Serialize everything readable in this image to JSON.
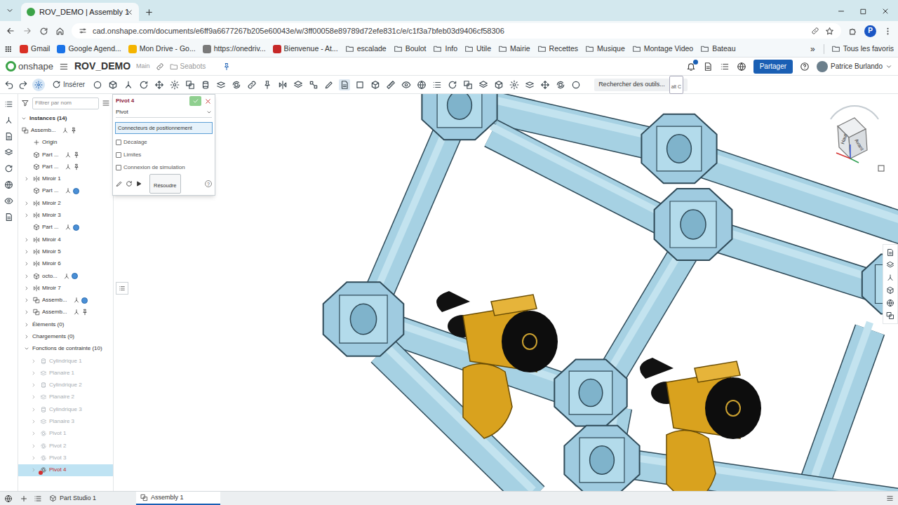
{
  "browser": {
    "tab_title": "ROV_DEMO | Assembly 1",
    "url": "cad.onshape.com/documents/e6ff9a6677267b205e60043e/w/3ff00058e89789d72efe831c/e/c1f3a7bfeb03d9406cf58306",
    "profile_initial": "P",
    "bookmarks": [
      {
        "label": "Gmail",
        "kind": "site",
        "color": "#d93025"
      },
      {
        "label": "Google Agend...",
        "kind": "site",
        "color": "#1a73e8"
      },
      {
        "label": "Mon Drive - Go...",
        "kind": "site",
        "color": "#f4b400"
      },
      {
        "label": "https://onedriv...",
        "kind": "site",
        "color": "#7a7a7a"
      },
      {
        "label": "Bienvenue - At...",
        "kind": "site",
        "color": "#c62828"
      },
      {
        "label": "escalade",
        "kind": "folder",
        "color": "#5f6368"
      },
      {
        "label": "Boulot",
        "kind": "folder",
        "color": "#5f6368"
      },
      {
        "label": "Info",
        "kind": "folder",
        "color": "#5f6368"
      },
      {
        "label": "Utile",
        "kind": "folder",
        "color": "#5f6368"
      },
      {
        "label": "Mairie",
        "kind": "folder",
        "color": "#5f6368"
      },
      {
        "label": "Recettes",
        "kind": "folder",
        "color": "#5f6368"
      },
      {
        "label": "Musique",
        "kind": "folder",
        "color": "#5f6368"
      },
      {
        "label": "Montage Video",
        "kind": "folder",
        "color": "#5f6368"
      },
      {
        "label": "Bateau",
        "kind": "folder",
        "color": "#5f6368"
      }
    ],
    "more": "»",
    "all_bookmarks": "Tous les favoris"
  },
  "onshape": {
    "logo": "onshape",
    "document": "ROV_DEMO",
    "branch": "Main",
    "folder": "Seabots",
    "share": "Partager",
    "user": "Patrice Burlando"
  },
  "toolbar": {
    "insert": "Insérer",
    "search_placeholder": "Rechercher des outils...",
    "shortcut": "alt C"
  },
  "tree": {
    "filter_placeholder": "Filtrer par nom",
    "instances_header": {
      "label": "Instances (14)",
      "expanded": true
    },
    "instances": [
      {
        "label": "Assemb...",
        "kind": "assembly",
        "level": 0,
        "expandable": false,
        "expanded": false,
        "fixed": true,
        "linked": false
      },
      {
        "label": "Origin",
        "kind": "origin",
        "level": 1,
        "expandable": false,
        "expanded": false,
        "fixed": false,
        "linked": false
      },
      {
        "label": "Part ...",
        "kind": "part",
        "level": 1,
        "expandable": false,
        "expanded": false,
        "fixed": true,
        "linked": false
      },
      {
        "label": "Part ...",
        "kind": "part",
        "level": 1,
        "expandable": false,
        "expanded": false,
        "fixed": true,
        "linked": false
      },
      {
        "label": "Miroir 1",
        "kind": "mirror",
        "level": 1,
        "expandable": true,
        "expanded": false,
        "fixed": false,
        "linked": false
      },
      {
        "label": "Part ...",
        "kind": "part",
        "level": 1,
        "expandable": false,
        "expanded": false,
        "fixed": false,
        "linked": true
      },
      {
        "label": "Miroir 2",
        "kind": "mirror",
        "level": 1,
        "expandable": true,
        "expanded": false,
        "fixed": false,
        "linked": false
      },
      {
        "label": "Miroir 3",
        "kind": "mirror",
        "level": 1,
        "expandable": true,
        "expanded": false,
        "fixed": false,
        "linked": false
      },
      {
        "label": "Part ...",
        "kind": "part",
        "level": 1,
        "expandable": false,
        "expanded": false,
        "fixed": false,
        "linked": true
      },
      {
        "label": "Miroir 4",
        "kind": "mirror",
        "level": 1,
        "expandable": true,
        "expanded": false,
        "fixed": false,
        "linked": false
      },
      {
        "label": "Miroir 5",
        "kind": "mirror",
        "level": 1,
        "expandable": true,
        "expanded": false,
        "fixed": false,
        "linked": false
      },
      {
        "label": "Miroir 6",
        "kind": "mirror",
        "level": 1,
        "expandable": true,
        "expanded": false,
        "fixed": false,
        "linked": false
      },
      {
        "label": "octo...",
        "kind": "part",
        "level": 1,
        "expandable": true,
        "expanded": false,
        "fixed": false,
        "linked": true
      },
      {
        "label": "Miroir 7",
        "kind": "mirror",
        "level": 1,
        "expandable": true,
        "expanded": false,
        "fixed": false,
        "linked": false
      },
      {
        "label": "Assemb...",
        "kind": "assembly",
        "level": 1,
        "expandable": true,
        "expanded": false,
        "fixed": false,
        "linked": true
      },
      {
        "label": "Assemb...",
        "kind": "assembly",
        "level": 1,
        "expandable": true,
        "expanded": false,
        "fixed": true,
        "linked": false
      }
    ],
    "sections": [
      {
        "label": "Éléments (0)",
        "expanded": false
      },
      {
        "label": "Chargements (0)",
        "expanded": false
      },
      {
        "label": "Fonctions de contrainte (10)",
        "expanded": true
      }
    ],
    "mates": [
      {
        "label": "Cylindrique 1",
        "kind": "cylindrical",
        "greyed": true,
        "selected": false,
        "error": false
      },
      {
        "label": "Planaire 1",
        "kind": "planar",
        "greyed": true,
        "selected": false,
        "error": false
      },
      {
        "label": "Cylindrique 2",
        "kind": "cylindrical",
        "greyed": true,
        "selected": false,
        "error": false
      },
      {
        "label": "Planaire 2",
        "kind": "planar",
        "greyed": true,
        "selected": false,
        "error": false
      },
      {
        "label": "Cylindrique 3",
        "kind": "cylindrical",
        "greyed": true,
        "selected": false,
        "error": false
      },
      {
        "label": "Planaire 3",
        "kind": "planar",
        "greyed": true,
        "selected": false,
        "error": false
      },
      {
        "label": "Pivot 1",
        "kind": "revolute",
        "greyed": true,
        "selected": false,
        "error": false
      },
      {
        "label": "Pivot 2",
        "kind": "revolute",
        "greyed": true,
        "selected": false,
        "error": false
      },
      {
        "label": "Pivot 3",
        "kind": "revolute",
        "greyed": true,
        "selected": false,
        "error": false
      },
      {
        "label": "Pivot 4",
        "kind": "revolute",
        "greyed": false,
        "selected": true,
        "error": true
      }
    ]
  },
  "dialog": {
    "title": "Pivot 4",
    "type": "Pivot",
    "field": "Connecteurs de positionnement",
    "options": [
      {
        "label": "Décalage",
        "checked": false
      },
      {
        "label": "Limites",
        "checked": false
      },
      {
        "label": "Connexion de simulation",
        "checked": false
      }
    ],
    "solve": "Résoudre",
    "help": "?"
  },
  "view_cube": {
    "top": "Haut",
    "front": "Avant"
  },
  "bottom_tabs": [
    {
      "label": "Part Studio 1",
      "selected": false
    },
    {
      "label": "Assembly 1",
      "selected": true
    }
  ]
}
